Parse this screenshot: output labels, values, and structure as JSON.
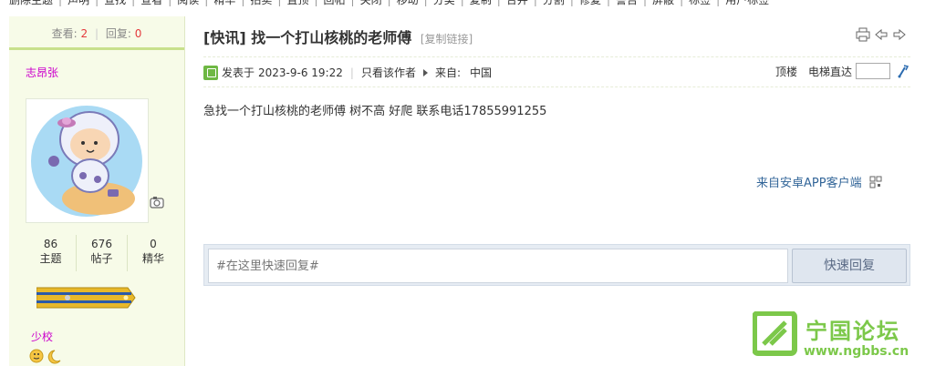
{
  "topnav": {
    "items": [
      "删除主题",
      "声明",
      "查找",
      "查看",
      "阅读",
      "精华",
      "拍卖",
      "置顶",
      "回帖",
      "关闭",
      "移动",
      "分类",
      "复制",
      "合并",
      "分割",
      "修复",
      "警告",
      "屏蔽",
      "标签",
      "用户标签"
    ]
  },
  "profile": {
    "views_label": "查看:",
    "views_value": "2",
    "replies_label": "回复:",
    "replies_value": "0",
    "username": "志昂张",
    "stats": [
      {
        "value": "86",
        "label": "主题"
      },
      {
        "value": "676",
        "label": "帖子"
      },
      {
        "value": "0",
        "label": "精华"
      }
    ],
    "rank": "少校"
  },
  "post": {
    "tag": "[快讯]",
    "title": "找一个打山核桃的老师傅",
    "copy_link": "[复制链接]",
    "posted_prefix": "发表于",
    "posted_time": "2023-9-6 19:22",
    "only_author": "只看该作者",
    "from_label": "来自:",
    "from_value": "中国",
    "floor_label": "顶楼",
    "jump_label": "电梯直达",
    "body": "急找一个打山核桃的老师傅  树不高 好爬  联系电话17855991255",
    "client": "来自安卓APP客户端"
  },
  "quick_reply": {
    "placeholder": "#在这里快速回复#",
    "button": "快速回复"
  },
  "watermark": {
    "name": "宁国论坛",
    "url": "www.ngbbs.cn"
  },
  "colors": {
    "accent_green": "#7cc84a",
    "username": "#cc00cc",
    "link_blue": "#336699",
    "count_red": "#e4393c"
  }
}
